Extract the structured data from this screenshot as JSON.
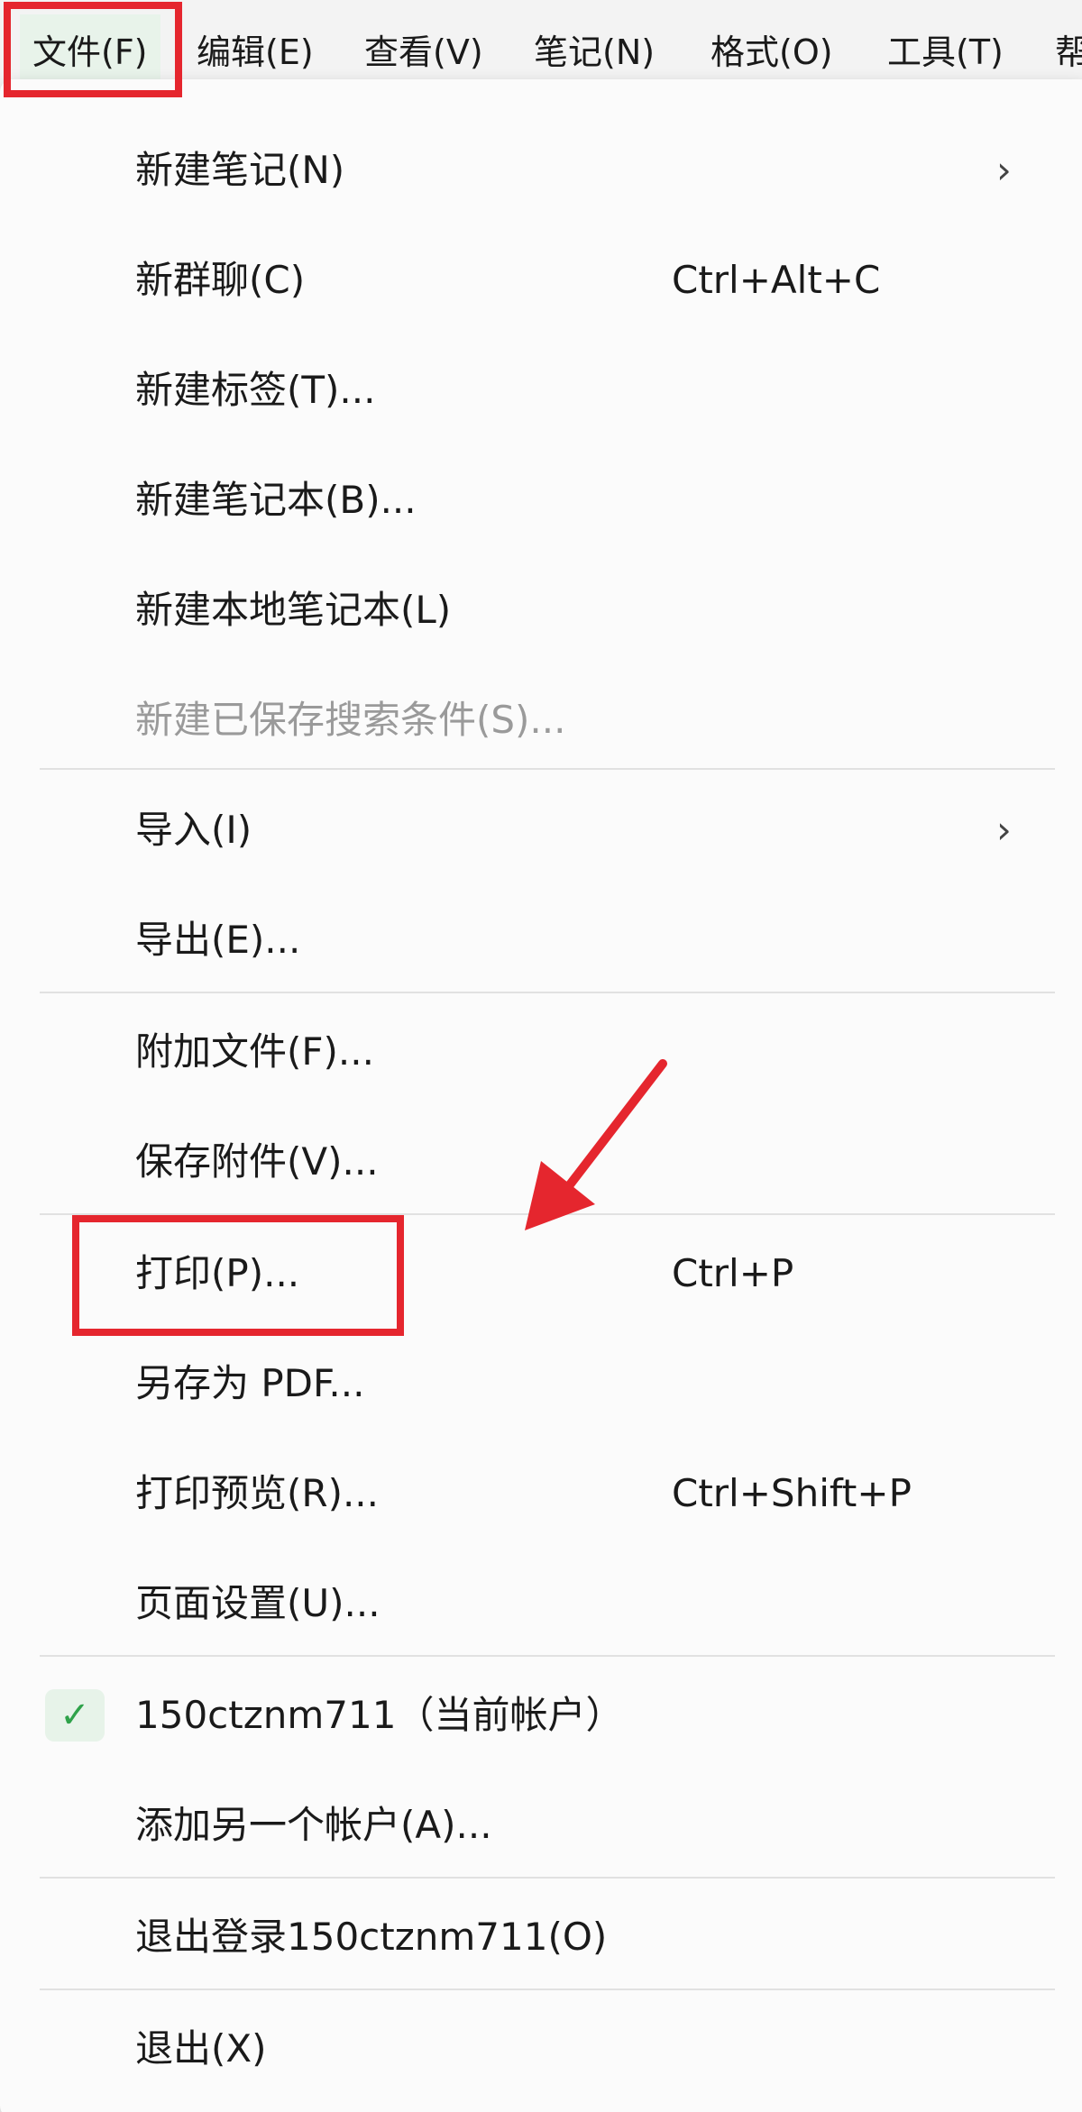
{
  "menubar": {
    "items": [
      {
        "label": "文件(F)"
      },
      {
        "label": "编辑(E)"
      },
      {
        "label": "查看(V)"
      },
      {
        "label": "笔记(N)"
      },
      {
        "label": "格式(O)"
      },
      {
        "label": "工具(T)"
      },
      {
        "label": "帮"
      }
    ]
  },
  "file_menu": {
    "new_note": {
      "label": "新建笔记(N)",
      "arrow": "›"
    },
    "new_group_chat": {
      "label": "新群聊(C)",
      "shortcut": "Ctrl+Alt+C"
    },
    "new_tag": {
      "label": "新建标签(T)..."
    },
    "new_notebook": {
      "label": "新建笔记本(B)..."
    },
    "new_local_notebook": {
      "label": "新建本地笔记本(L)"
    },
    "new_saved_search": {
      "label": "新建已保存搜索条件(S)..."
    },
    "import": {
      "label": "导入(I)",
      "arrow": "›"
    },
    "export": {
      "label": "导出(E)..."
    },
    "attach_file": {
      "label": "附加文件(F)..."
    },
    "save_attachment": {
      "label": "保存附件(V)..."
    },
    "print": {
      "label": "打印(P)...",
      "shortcut": "Ctrl+P"
    },
    "save_pdf": {
      "label": "另存为 PDF..."
    },
    "print_preview": {
      "label": "打印预览(R)...",
      "shortcut": "Ctrl+Shift+P"
    },
    "page_setup": {
      "label": "页面设置(U)..."
    },
    "current_account": {
      "label": "150ctznm711（当前帐户）",
      "check": "✓"
    },
    "add_account": {
      "label": "添加另一个帐户(A)..."
    },
    "sign_out": {
      "label": "退出登录150ctznm711(O)"
    },
    "exit": {
      "label": "退出(X)"
    }
  },
  "colors": {
    "annotation": "#e5262e",
    "accent": "#2fa24a"
  }
}
